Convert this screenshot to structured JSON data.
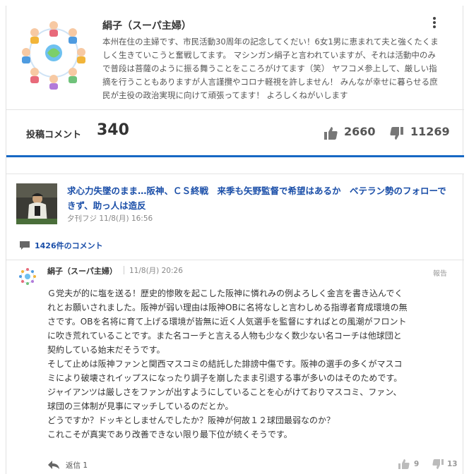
{
  "profile": {
    "name": "絹子（スーパ主婦）",
    "bio": "本州在住の主婦です、市民活動30周年の記念してくだい！6女1男に恵まれて夫と強くたくましく生きていこうと奮戦してます。 マシンガン絹子と言われていますが、それは活動中のみで普段は菩薩のように振る舞うことをこころがけてます（笑） ヤフコメ参上して、厳しい指摘を行うこともありますが人言謹攬やコロナ軽視を許しません！ みんなが幸せに暮らせる庶民が主役の政治実現に向けて頑張ってます！ よろしくねがいします",
    "more_icon": "more-vertical-icon"
  },
  "stats": {
    "label": "投稿コメント",
    "count": "340",
    "likes": "2660",
    "dislikes": "11269"
  },
  "article": {
    "title": "求心力失墜のまま…阪神、ＣＳ終戦　来季も矢野監督で希望はあるか　ベテラン勢のフォローできず、助っ人は造反",
    "source": "夕刊フジ 11/8(月) 16:56",
    "comment_count": "1426件のコメント"
  },
  "comment": {
    "author": "絹子（スーパ主婦）",
    "time": "11/8(月) 20:26",
    "report": "報告",
    "lines": [
      "Ｇ党夫が的に塩を送る！歴史的惨敗を起こした阪神に憐れみの例よろしく金言を書き込んでく",
      "れとお願いされました。阪神が弱い理由は阪神OBに名将なしと言わしめる指導者育成環境の無",
      "さです。OBを名将に育て上げる環境が皆無に近く人気選手を監督にすればとの風潮がフロント",
      "に吹き荒れていることです。また名コーチと言える人物も少なく数少ない名コーチは他球団と",
      "契約している始末だそうです。",
      "そして止めは阪神ファンと関西マスコミの結託した誹謗中傷です。阪神の選手の多くがマスコ",
      "ミにより破壊されイップスになったり調子を崩したまま引退する事が多いのはそのためです。",
      "ジャイアンツは厳しさをファンが出すようにしていることを心がけておりマスコミ、ファン、",
      "球団の三体制が見事にマッチしているのだとか。",
      "どうですか？ドッキとしませんでしたか？阪神が何故１２球団最弱なのか？",
      "これこそが真実であり改善できない限り最下位が続くそうです。"
    ],
    "reply": "返信 1",
    "likes": "9",
    "dislikes": "13"
  },
  "colors": {
    "accent": "#1668c4",
    "link": "#1a4ea8",
    "icon_gray": "#777777"
  }
}
